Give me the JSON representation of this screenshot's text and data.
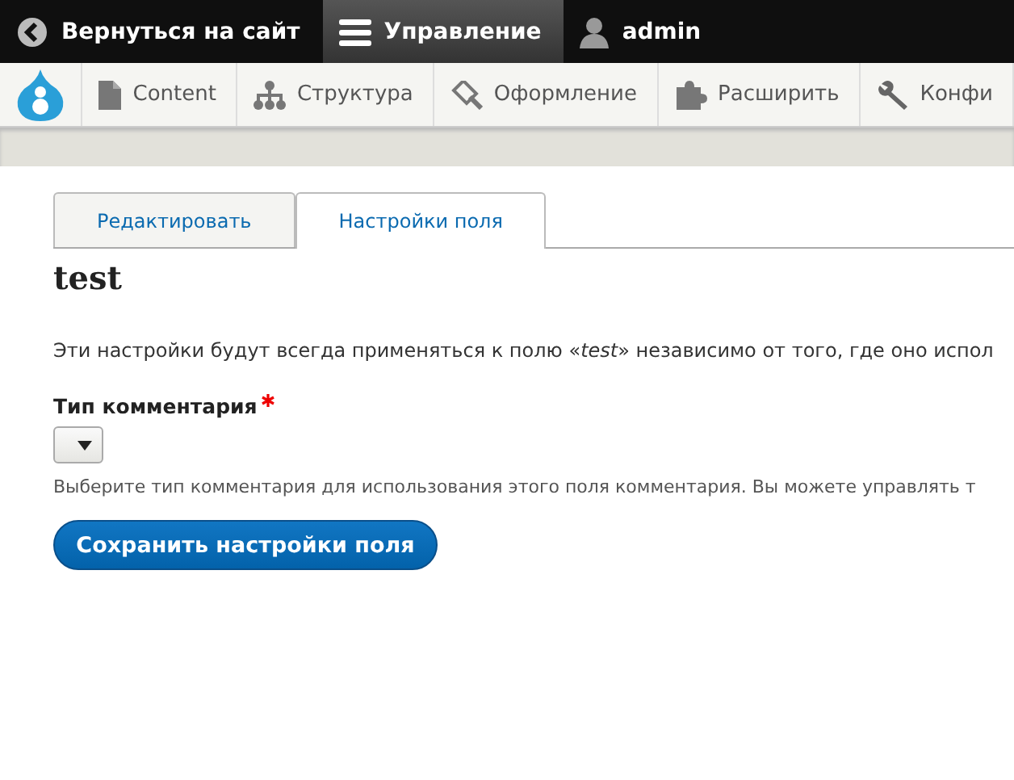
{
  "toolbar": [
    {
      "kind": "back",
      "label": "Вернуться на сайт",
      "selected": false
    },
    {
      "kind": "menu",
      "label": "Управление",
      "selected": true
    },
    {
      "kind": "user",
      "label": "admin",
      "selected": false
    }
  ],
  "admin_menu": [
    {
      "kind": "content",
      "label": "Content"
    },
    {
      "kind": "structure",
      "label": "Структура"
    },
    {
      "kind": "appearance",
      "label": "Оформление"
    },
    {
      "kind": "extend",
      "label": "Расширить"
    },
    {
      "kind": "config",
      "label": "Конфи"
    }
  ],
  "tabs": [
    {
      "label": "Редактировать",
      "selected": false
    },
    {
      "label": "Настройки поля",
      "selected": true
    }
  ],
  "title": "test",
  "intro": "Эти настройки будут всегда применяться к полю «*test*» независимо от того, где оно испол",
  "field": {
    "label": "Тип комментария",
    "required": true,
    "description": "Выберите тип комментария для использования этого поля комментария. Вы можете управлять т"
  },
  "save_button": "Сохранить настройки поля"
}
